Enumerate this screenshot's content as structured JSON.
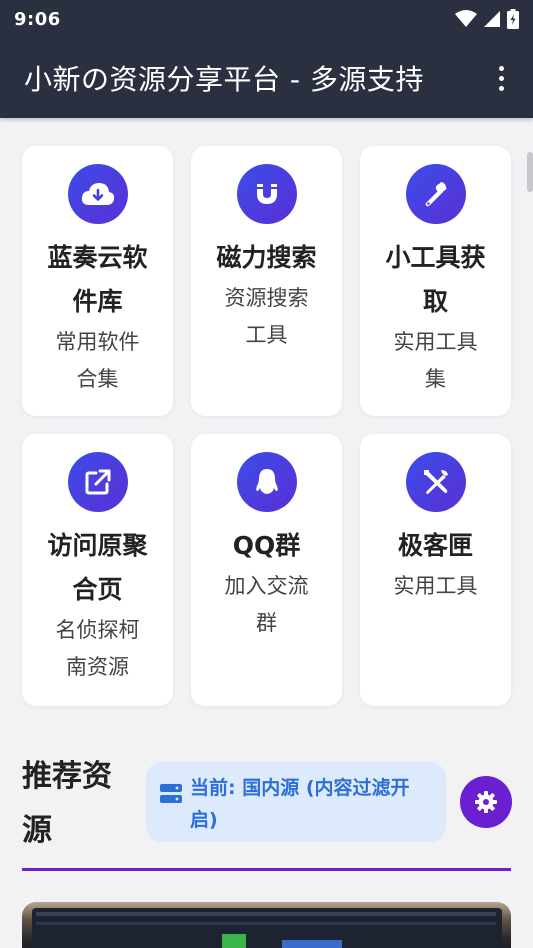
{
  "status_bar": {
    "time": "9:06"
  },
  "app_bar": {
    "title": "小新の资源分享平台 - 多源支持"
  },
  "cards": [
    {
      "title": "蓝奏云软件库",
      "desc": "常用软件合集",
      "icon": "cloud-download-icon"
    },
    {
      "title": "磁力搜索",
      "desc": "资源搜索工具",
      "icon": "magnet-icon"
    },
    {
      "title": "小工具获取",
      "desc": "实用工具集",
      "icon": "wrench-icon"
    },
    {
      "title": "访问原聚合页",
      "desc": "名侦探柯南资源",
      "icon": "external-link-icon"
    },
    {
      "title": "QQ群",
      "desc": "加入交流群",
      "icon": "qq-icon"
    },
    {
      "title": "极客匣",
      "desc": "实用工具",
      "icon": "tools-icon"
    }
  ],
  "recommend": {
    "title": "推荐资源",
    "source_label": "当前: 国内源 (内容过滤开启)"
  },
  "colors": {
    "bar_bg": "#2b3040",
    "accent_purple": "#6a1fd1",
    "chip_bg": "#dceafb",
    "chip_text": "#2d6fd6"
  }
}
